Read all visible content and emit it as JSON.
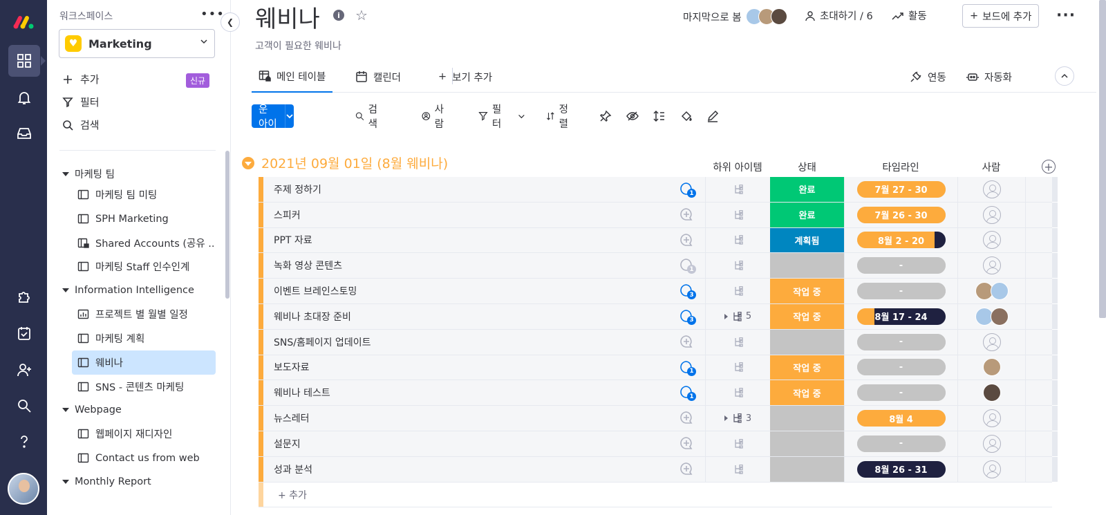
{
  "workspace": {
    "label": "워크스페이스",
    "name": "Marketing"
  },
  "sidebar": {
    "actions": [
      {
        "label": "추가",
        "badge": "신규"
      },
      {
        "label": "필터"
      },
      {
        "label": "검색"
      }
    ],
    "folders": [
      {
        "label": "마케팅 팀",
        "items": [
          "마케팅 팀 미팅",
          "SPH Marketing",
          "Shared Accounts (공유 ...",
          "마케팅 Staff 인수인계"
        ]
      },
      {
        "label": "Information Intelligence",
        "items": [
          "프로젝트 별 월별 일정",
          "마케팅 계획",
          "웨비나",
          "SNS - 콘텐츠 마케팅"
        ]
      },
      {
        "label": "Webpage",
        "items": [
          "웹페이지 재디자인",
          "Contact us from web"
        ]
      },
      {
        "label": "Monthly Report",
        "items": []
      }
    ],
    "selected": "웨비나"
  },
  "header": {
    "title": "웨비나",
    "subtitle": "고객이 필요한 웨비나",
    "last_seen": "마지막으로 봄",
    "invite": "초대하기 / 6",
    "activity": "활동",
    "add_to_board": "보드에 추가"
  },
  "tabs": {
    "main_table": "메인 테이블",
    "calendar": "캘린더",
    "add_view": "보기 추가",
    "integrate": "연동",
    "automate": "자동화"
  },
  "toolbar": {
    "new_item": "새로운 아이템",
    "search": "검색",
    "person": "사람",
    "filter": "필터",
    "sort": "정렬"
  },
  "group": {
    "title": "2021년 09월 01일 (8월 웨비나)",
    "color": "#fdab3d",
    "columns": {
      "subitems": "하위 아이템",
      "status": "상태",
      "timeline": "타임라인",
      "person": "사람"
    },
    "add_item": "+ 추가"
  },
  "status_colors": {
    "완료": "#00c875",
    "계획됨": "#0086c0",
    "작업 중": "#fdab3d",
    "": "#c4c4c4"
  },
  "rows": [
    {
      "name": "주제 정하기",
      "updates": "1",
      "sub": "",
      "status": "완료",
      "timeline": "7월 27 - 30",
      "tl_color": "#fdab3d",
      "tl_fill": 1,
      "persons": []
    },
    {
      "name": "스피커",
      "updates": "",
      "sub": "",
      "status": "완료",
      "timeline": "7월 26 - 30",
      "tl_color": "#fdab3d",
      "tl_fill": 1,
      "persons": []
    },
    {
      "name": "PPT 자료",
      "updates": "",
      "sub": "",
      "status": "계획됨",
      "timeline": "8월 2 - 20",
      "tl_color": "#fdab3d",
      "tl_fill": 0.88,
      "persons": []
    },
    {
      "name": "녹화 영상 콘텐츠",
      "updates": "1g",
      "sub": "",
      "status": "",
      "timeline": "-",
      "tl_color": "#c4c4c4",
      "tl_fill": 1,
      "persons": []
    },
    {
      "name": "이벤트 브레인스토밍",
      "updates": "3",
      "sub": "",
      "status": "작업 중",
      "timeline": "-",
      "tl_color": "#c4c4c4",
      "tl_fill": 1,
      "persons": [
        "#b89a7a",
        "#a8c8e8"
      ]
    },
    {
      "name": "웨비나 초대장 준비",
      "updates": "3",
      "sub": "5",
      "status": "작업 중",
      "timeline": "8월 17 - 24",
      "tl_color": "#fdab3d",
      "tl_fill": 0.2,
      "persons": [
        "#a8c8e8",
        "#8a7060"
      ]
    },
    {
      "name": "SNS/홈페이지 업데이트",
      "updates": "",
      "sub": "",
      "status": "",
      "timeline": "-",
      "tl_color": "#c4c4c4",
      "tl_fill": 1,
      "persons": []
    },
    {
      "name": "보도자료",
      "updates": "1",
      "sub": "",
      "status": "작업 중",
      "timeline": "-",
      "tl_color": "#c4c4c4",
      "tl_fill": 1,
      "persons": [
        "#b89a7a"
      ]
    },
    {
      "name": "웨비나 테스트",
      "updates": "1",
      "sub": "",
      "status": "작업 중",
      "timeline": "-",
      "tl_color": "#c4c4c4",
      "tl_fill": 1,
      "persons": [
        "#5a4a40"
      ]
    },
    {
      "name": "뉴스레터",
      "updates": "",
      "sub": "3",
      "status": "",
      "timeline": "8월 4",
      "tl_color": "#fdab3d",
      "tl_fill": 1,
      "persons": []
    },
    {
      "name": "설문지",
      "updates": "",
      "sub": "",
      "status": "",
      "timeline": "-",
      "tl_color": "#c4c4c4",
      "tl_fill": 1,
      "persons": []
    },
    {
      "name": "성과 분석",
      "updates": "",
      "sub": "",
      "status": "",
      "timeline": "8월 26 - 31",
      "tl_color": "#1f2140",
      "tl_fill": 1,
      "persons": []
    }
  ]
}
